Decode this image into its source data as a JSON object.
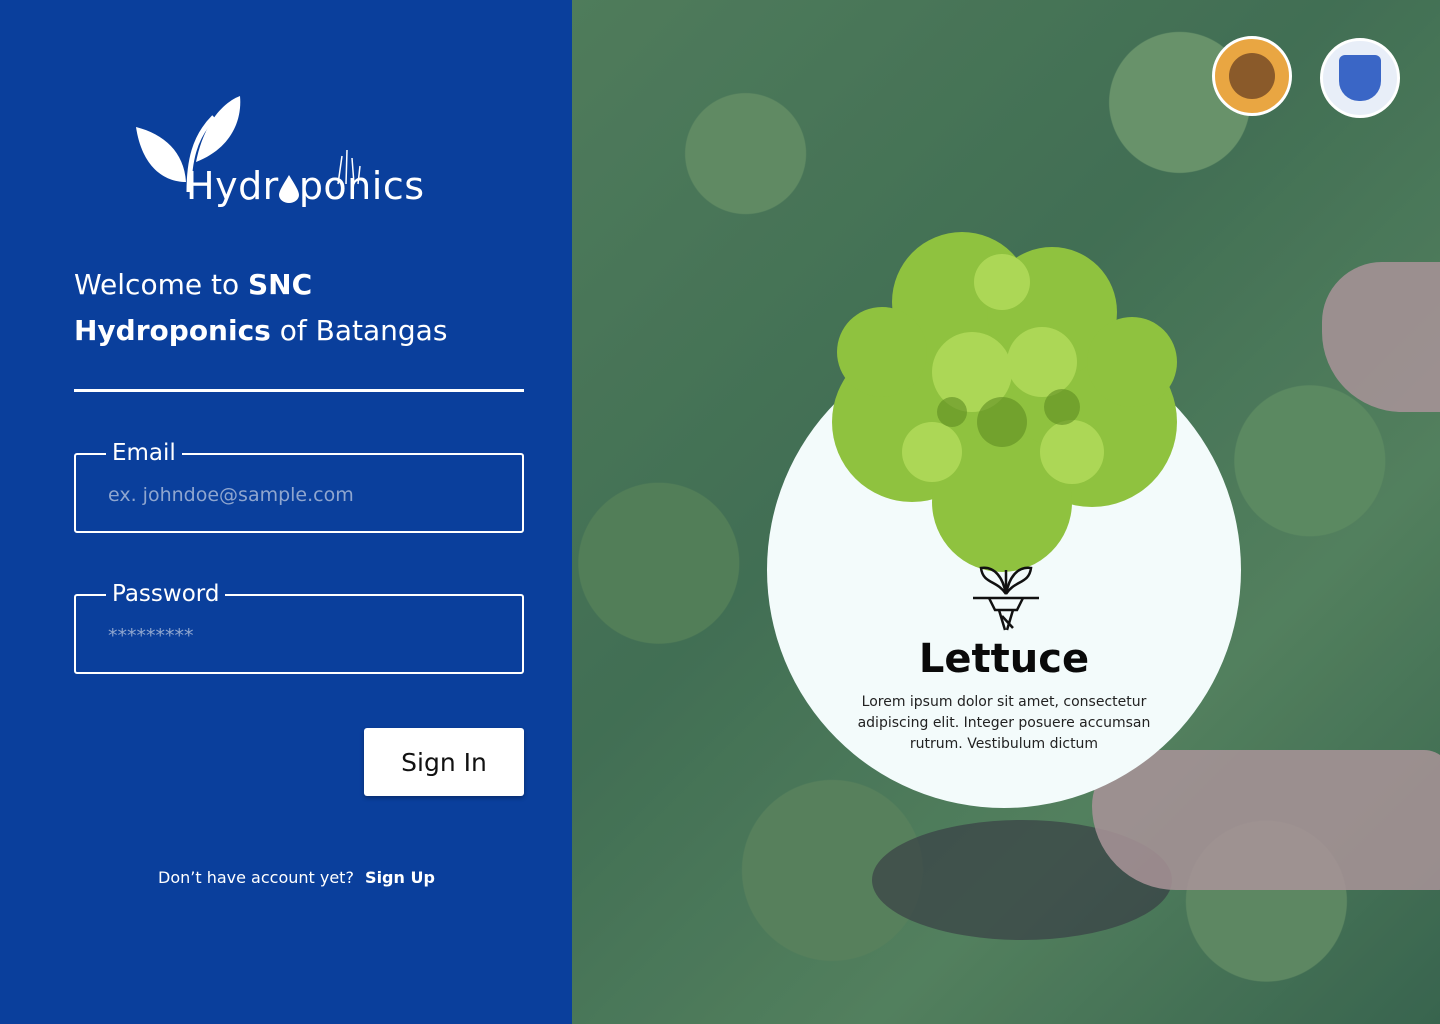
{
  "brand": {
    "logo_text_1": "Hydr",
    "logo_text_2": "ponics"
  },
  "welcome": {
    "line_1_prefix": "Welcome to ",
    "line_1_bold": "SNC",
    "line_2_bold": "Hydroponics",
    "line_2_suffix": " of Batangas"
  },
  "form": {
    "email_label": "Email",
    "email_placeholder": "ex. johndoe@sample.com",
    "password_label": "Password",
    "password_placeholder": "*********",
    "signin_label": "Sign In",
    "signup_prompt": "Don’t have account yet?",
    "signup_link": "Sign Up"
  },
  "card": {
    "title": "Lettuce",
    "description": "Lorem ipsum dolor sit amet, consectetur adipiscing elit. Integer posuere  accumsan rutrum. Vestibulum dictum"
  },
  "icons": {
    "logo": "sprout-leaf-icon",
    "seal_1": "dept-computer-engineering-seal",
    "seal_2": "snc-college-seal",
    "card_icon": "hydroponic-plant-icon"
  },
  "colors": {
    "panel_blue": "#0a3f9c",
    "card_bg": "#f3fbfb"
  }
}
